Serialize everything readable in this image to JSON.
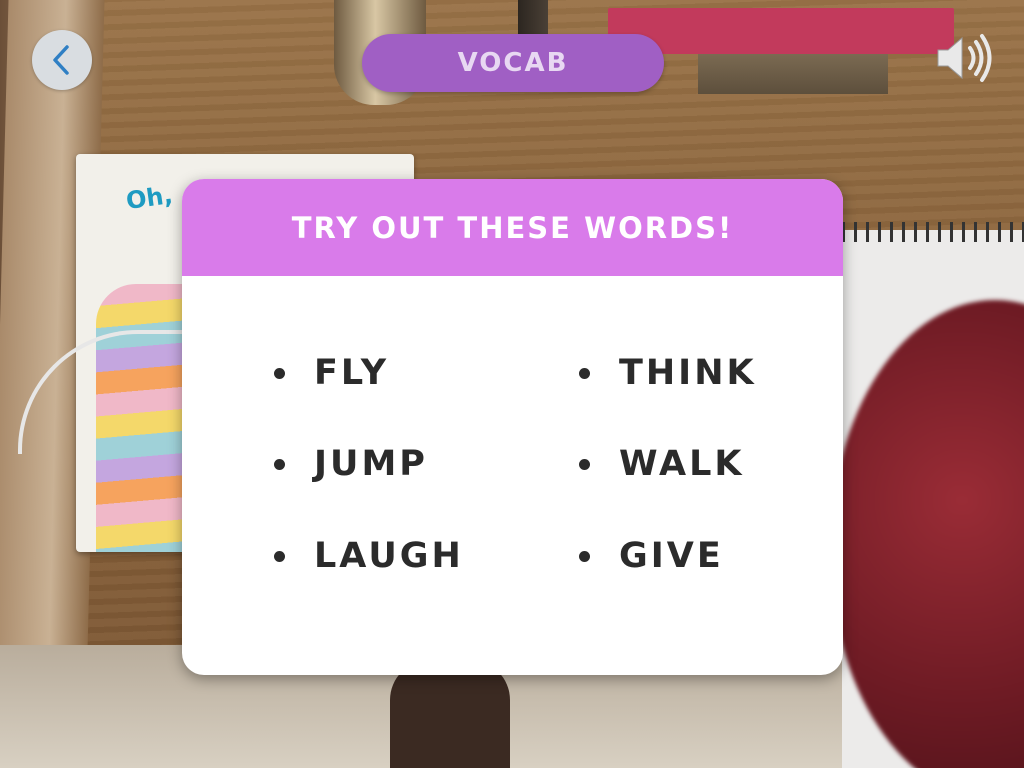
{
  "header": {
    "title": "VOCAB",
    "back_icon": "chevron-left-icon",
    "sound_icon": "speaker-icon"
  },
  "card": {
    "title": "TRY OUT THESE WORDS!",
    "words_left": [
      "FLY",
      "JUMP",
      "LAUGH"
    ],
    "words_right": [
      "THINK",
      "WALK",
      "GIVE"
    ]
  },
  "background": {
    "book_title": "Oh,"
  },
  "colors": {
    "header_pill": "#a05fc4",
    "card_header": "#d97bea",
    "back_button": "#d9dde1",
    "back_chevron": "#2f7fc4",
    "word_text": "#2b2b2b"
  }
}
